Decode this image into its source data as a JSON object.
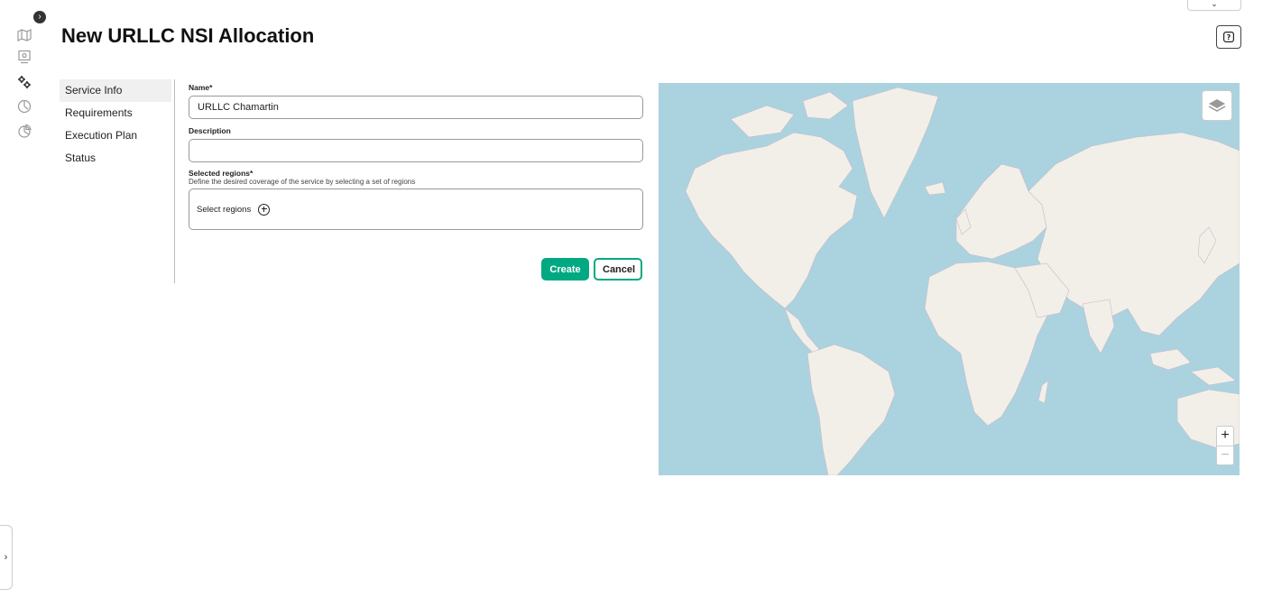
{
  "page": {
    "title": "New URLLC NSI Allocation"
  },
  "steps": [
    {
      "label": "Service Info",
      "active": true
    },
    {
      "label": "Requirements",
      "active": false
    },
    {
      "label": "Execution Plan",
      "active": false
    },
    {
      "label": "Status",
      "active": false
    }
  ],
  "form": {
    "name": {
      "label": "Name*",
      "value": "URLLC Chamartin"
    },
    "description": {
      "label": "Description",
      "value": ""
    },
    "regions": {
      "label": "Selected regions*",
      "hint": "Define the desired coverage of the service by selecting a set of regions",
      "select_label": "Select regions"
    },
    "create_label": "Create",
    "cancel_label": "Cancel"
  },
  "map": {
    "zoom_in": "+",
    "zoom_out": "−"
  },
  "rail": {
    "toggle": "›",
    "expand": "›"
  },
  "top": {
    "dropdown": "⌄"
  },
  "colors": {
    "accent": "#01a982",
    "water": "#aad3df",
    "land": "#f2efe9"
  }
}
